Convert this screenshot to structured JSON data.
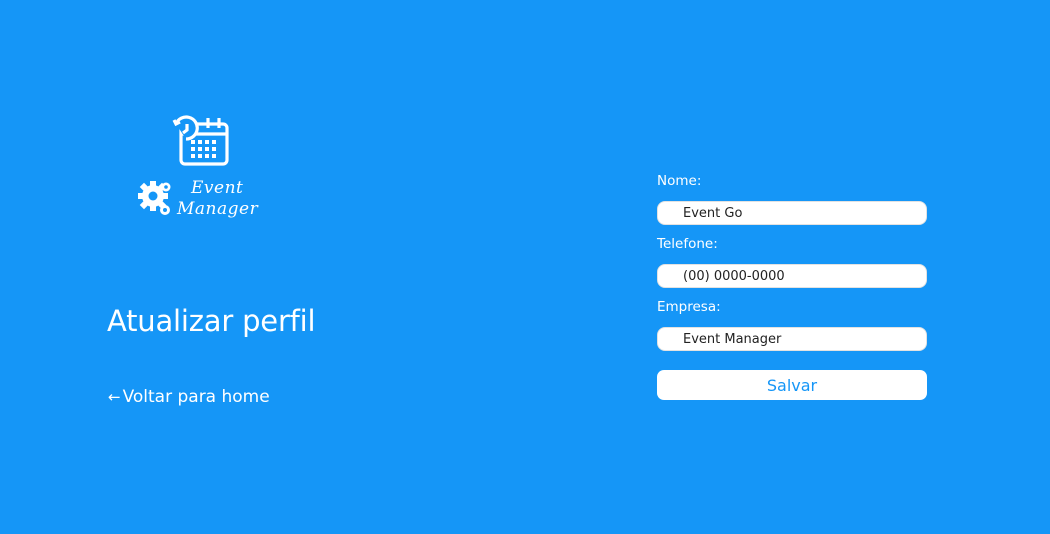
{
  "logo": {
    "line1": "Event",
    "line2": "Manager",
    "icons": [
      "calendar-clock-icon",
      "gears-icon"
    ]
  },
  "page": {
    "title": "Atualizar perfil",
    "back_icon": "arrow-left-icon",
    "back_arrow": "←",
    "back_label": "Voltar para home"
  },
  "form": {
    "fields": [
      {
        "label": "Nome:",
        "value": "Event Go"
      },
      {
        "label": "Telefone:",
        "value": "(00) 0000-0000"
      },
      {
        "label": "Empresa:",
        "value": "Event Manager"
      }
    ],
    "save_label": "Salvar"
  },
  "colors": {
    "background": "#1596f7",
    "button_text": "#1596f7",
    "input_bg": "#ffffff"
  }
}
